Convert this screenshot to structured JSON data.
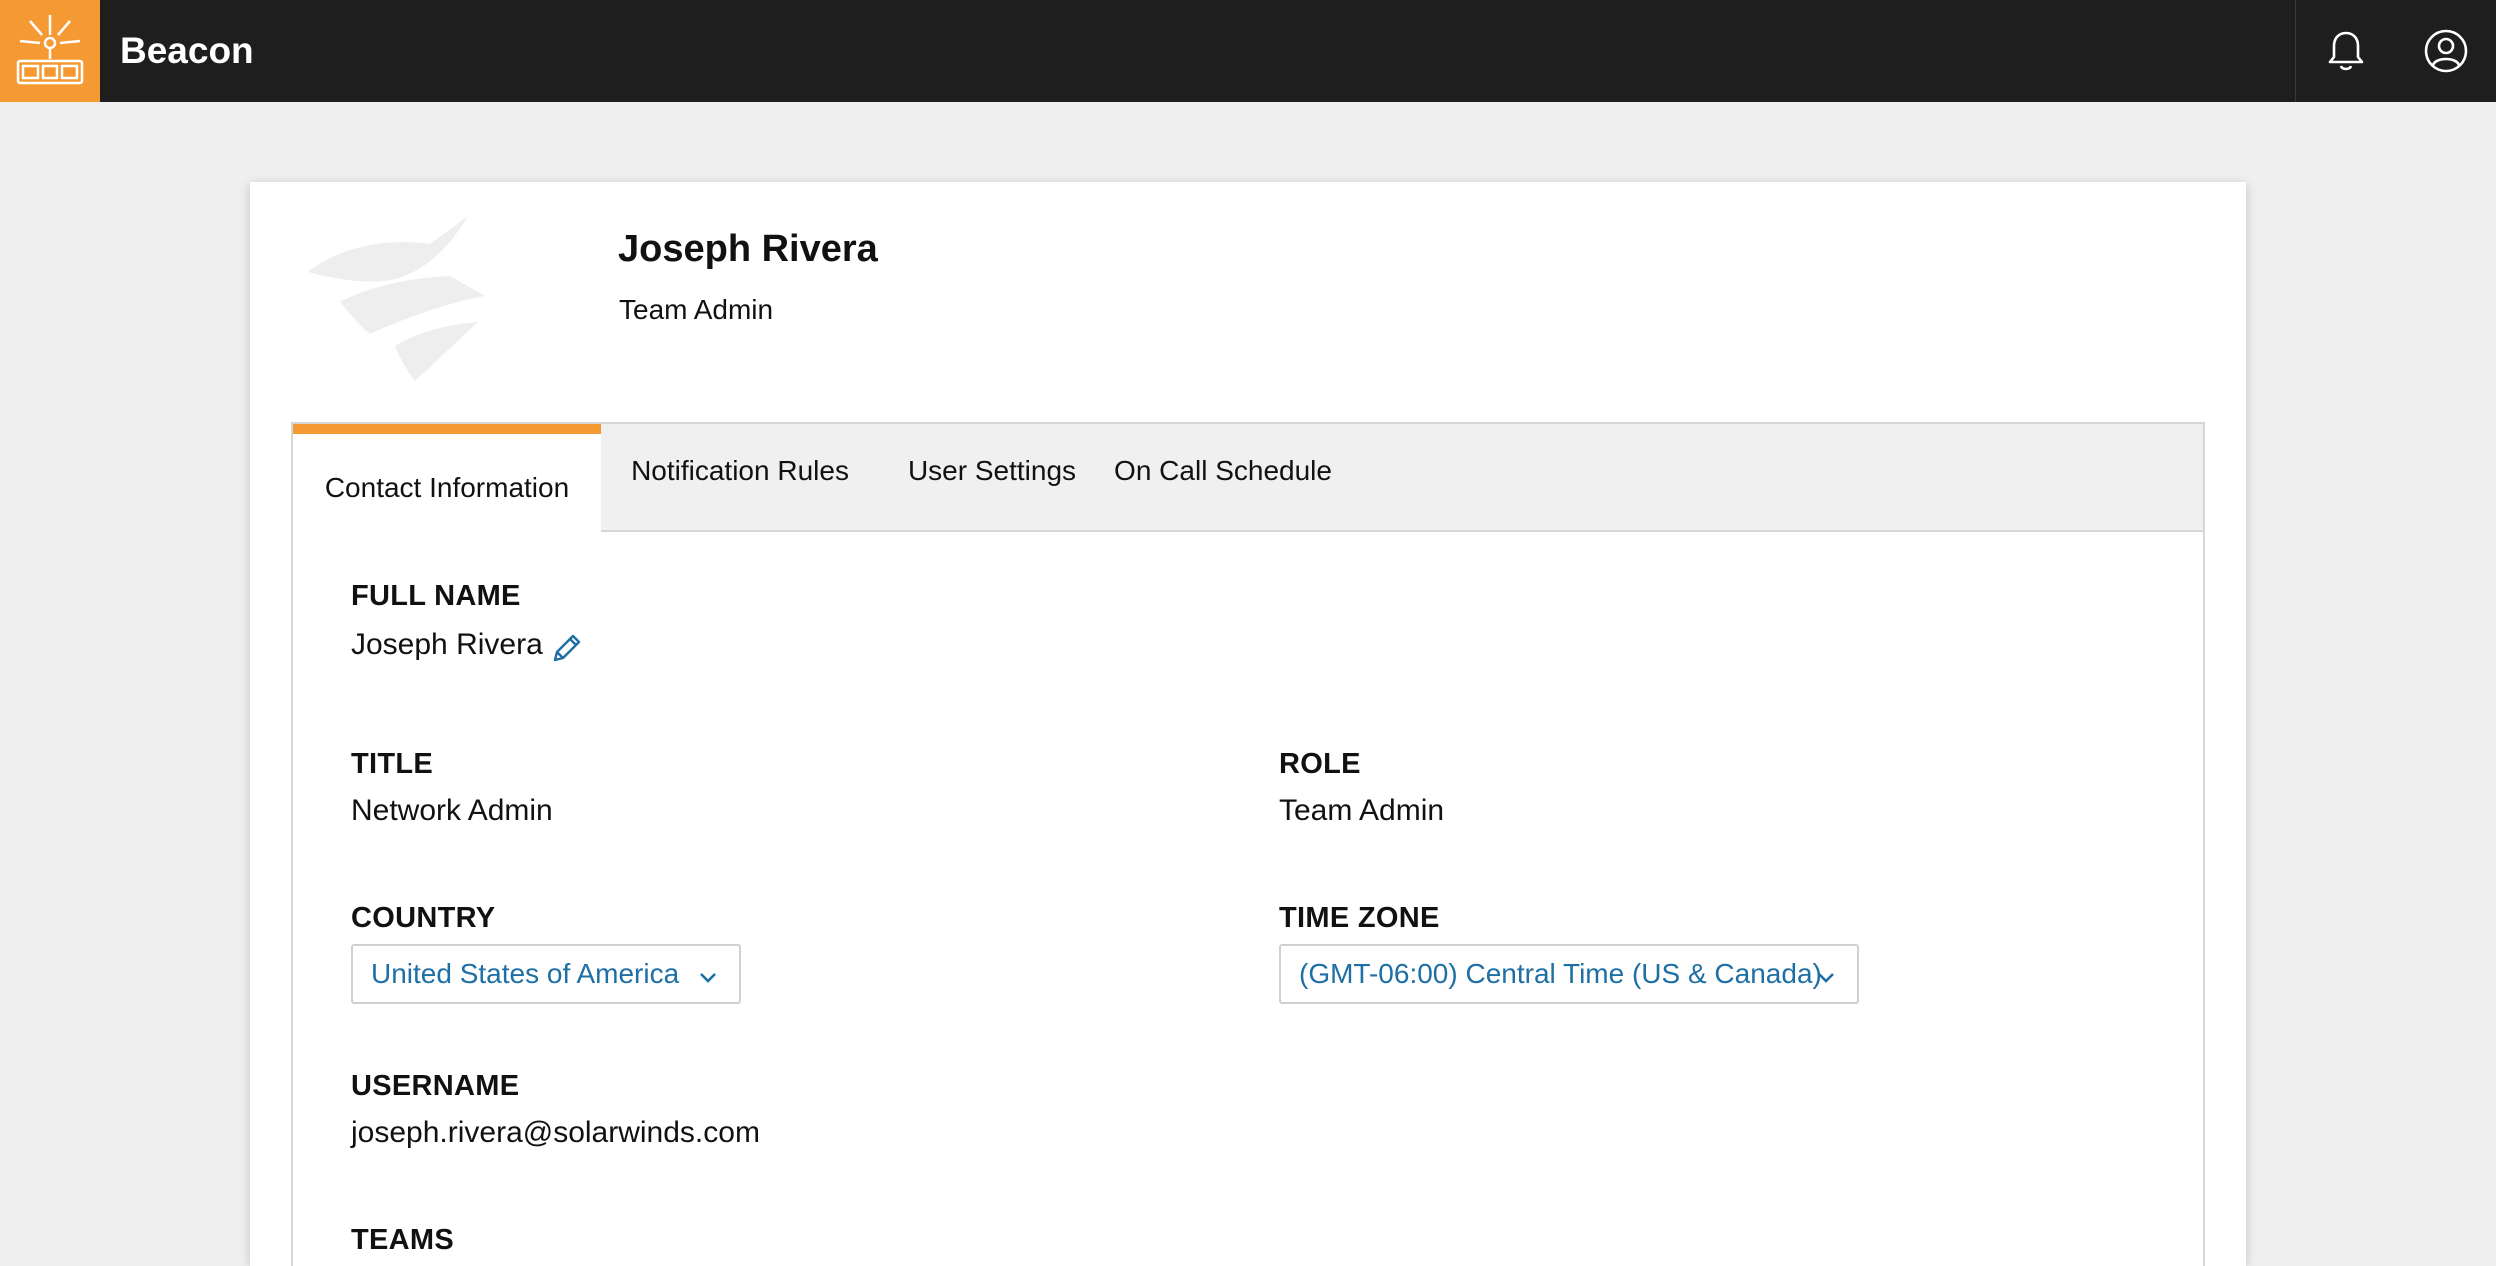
{
  "app": {
    "name": "Beacon"
  },
  "icons": {
    "logo": "beacon-logo-icon",
    "bell": "bell-icon",
    "user": "user-circle-icon",
    "edit": "pencil-icon",
    "chevron": "chevron-down-icon"
  },
  "colors": {
    "accent": "#f59a32",
    "topbar": "#1e1e1e",
    "link": "#1d6fa5"
  },
  "profile": {
    "name": "Joseph Rivera",
    "role": "Team Admin"
  },
  "tabs": [
    {
      "label": "Contact Information",
      "active": true
    },
    {
      "label": "Notification Rules",
      "active": false
    },
    {
      "label": "User Settings",
      "active": false
    },
    {
      "label": "On Call Schedule",
      "active": false
    }
  ],
  "fields": {
    "full_name": {
      "label": "FULL NAME",
      "value": "Joseph Rivera"
    },
    "title": {
      "label": "TITLE",
      "value": "Network Admin"
    },
    "role": {
      "label": "ROLE",
      "value": "Team Admin"
    },
    "country": {
      "label": "COUNTRY",
      "value": "United States of America"
    },
    "time_zone": {
      "label": "TIME ZONE",
      "value": "(GMT-06:00) Central Time (US & Canada)"
    },
    "username": {
      "label": "USERNAME",
      "value": "joseph.rivera@solarwinds.com"
    },
    "teams": {
      "label": "TEAMS"
    }
  }
}
